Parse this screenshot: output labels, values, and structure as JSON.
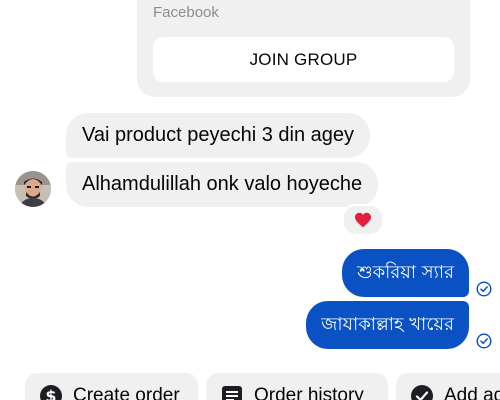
{
  "shared_group": {
    "source": "Facebook",
    "join_label": "JOIN GROUP"
  },
  "messages_incoming": [
    {
      "text": "Vai product peyechi 3 din agey"
    },
    {
      "text": "Alhamdulillah onk valo hoyeche",
      "reaction": "red-heart-icon"
    }
  ],
  "messages_outgoing": [
    {
      "text": "শুকরিয়া স্যার",
      "status": "sent-check-icon"
    },
    {
      "text": "জাযাকাল্লাহ খায়ের",
      "status": "sent-check-icon"
    }
  ],
  "quick_actions": [
    {
      "label": "Create order",
      "icon": "dollar-icon"
    },
    {
      "label": "Order history",
      "icon": "list-icon"
    },
    {
      "label": "Add ad",
      "icon": "check-icon"
    }
  ],
  "colors": {
    "incoming_bubble": "#f0f0f0",
    "outgoing_bubble": "#0a52c4",
    "status_icon": "#0a52c4",
    "reaction": "#e41e3f"
  }
}
